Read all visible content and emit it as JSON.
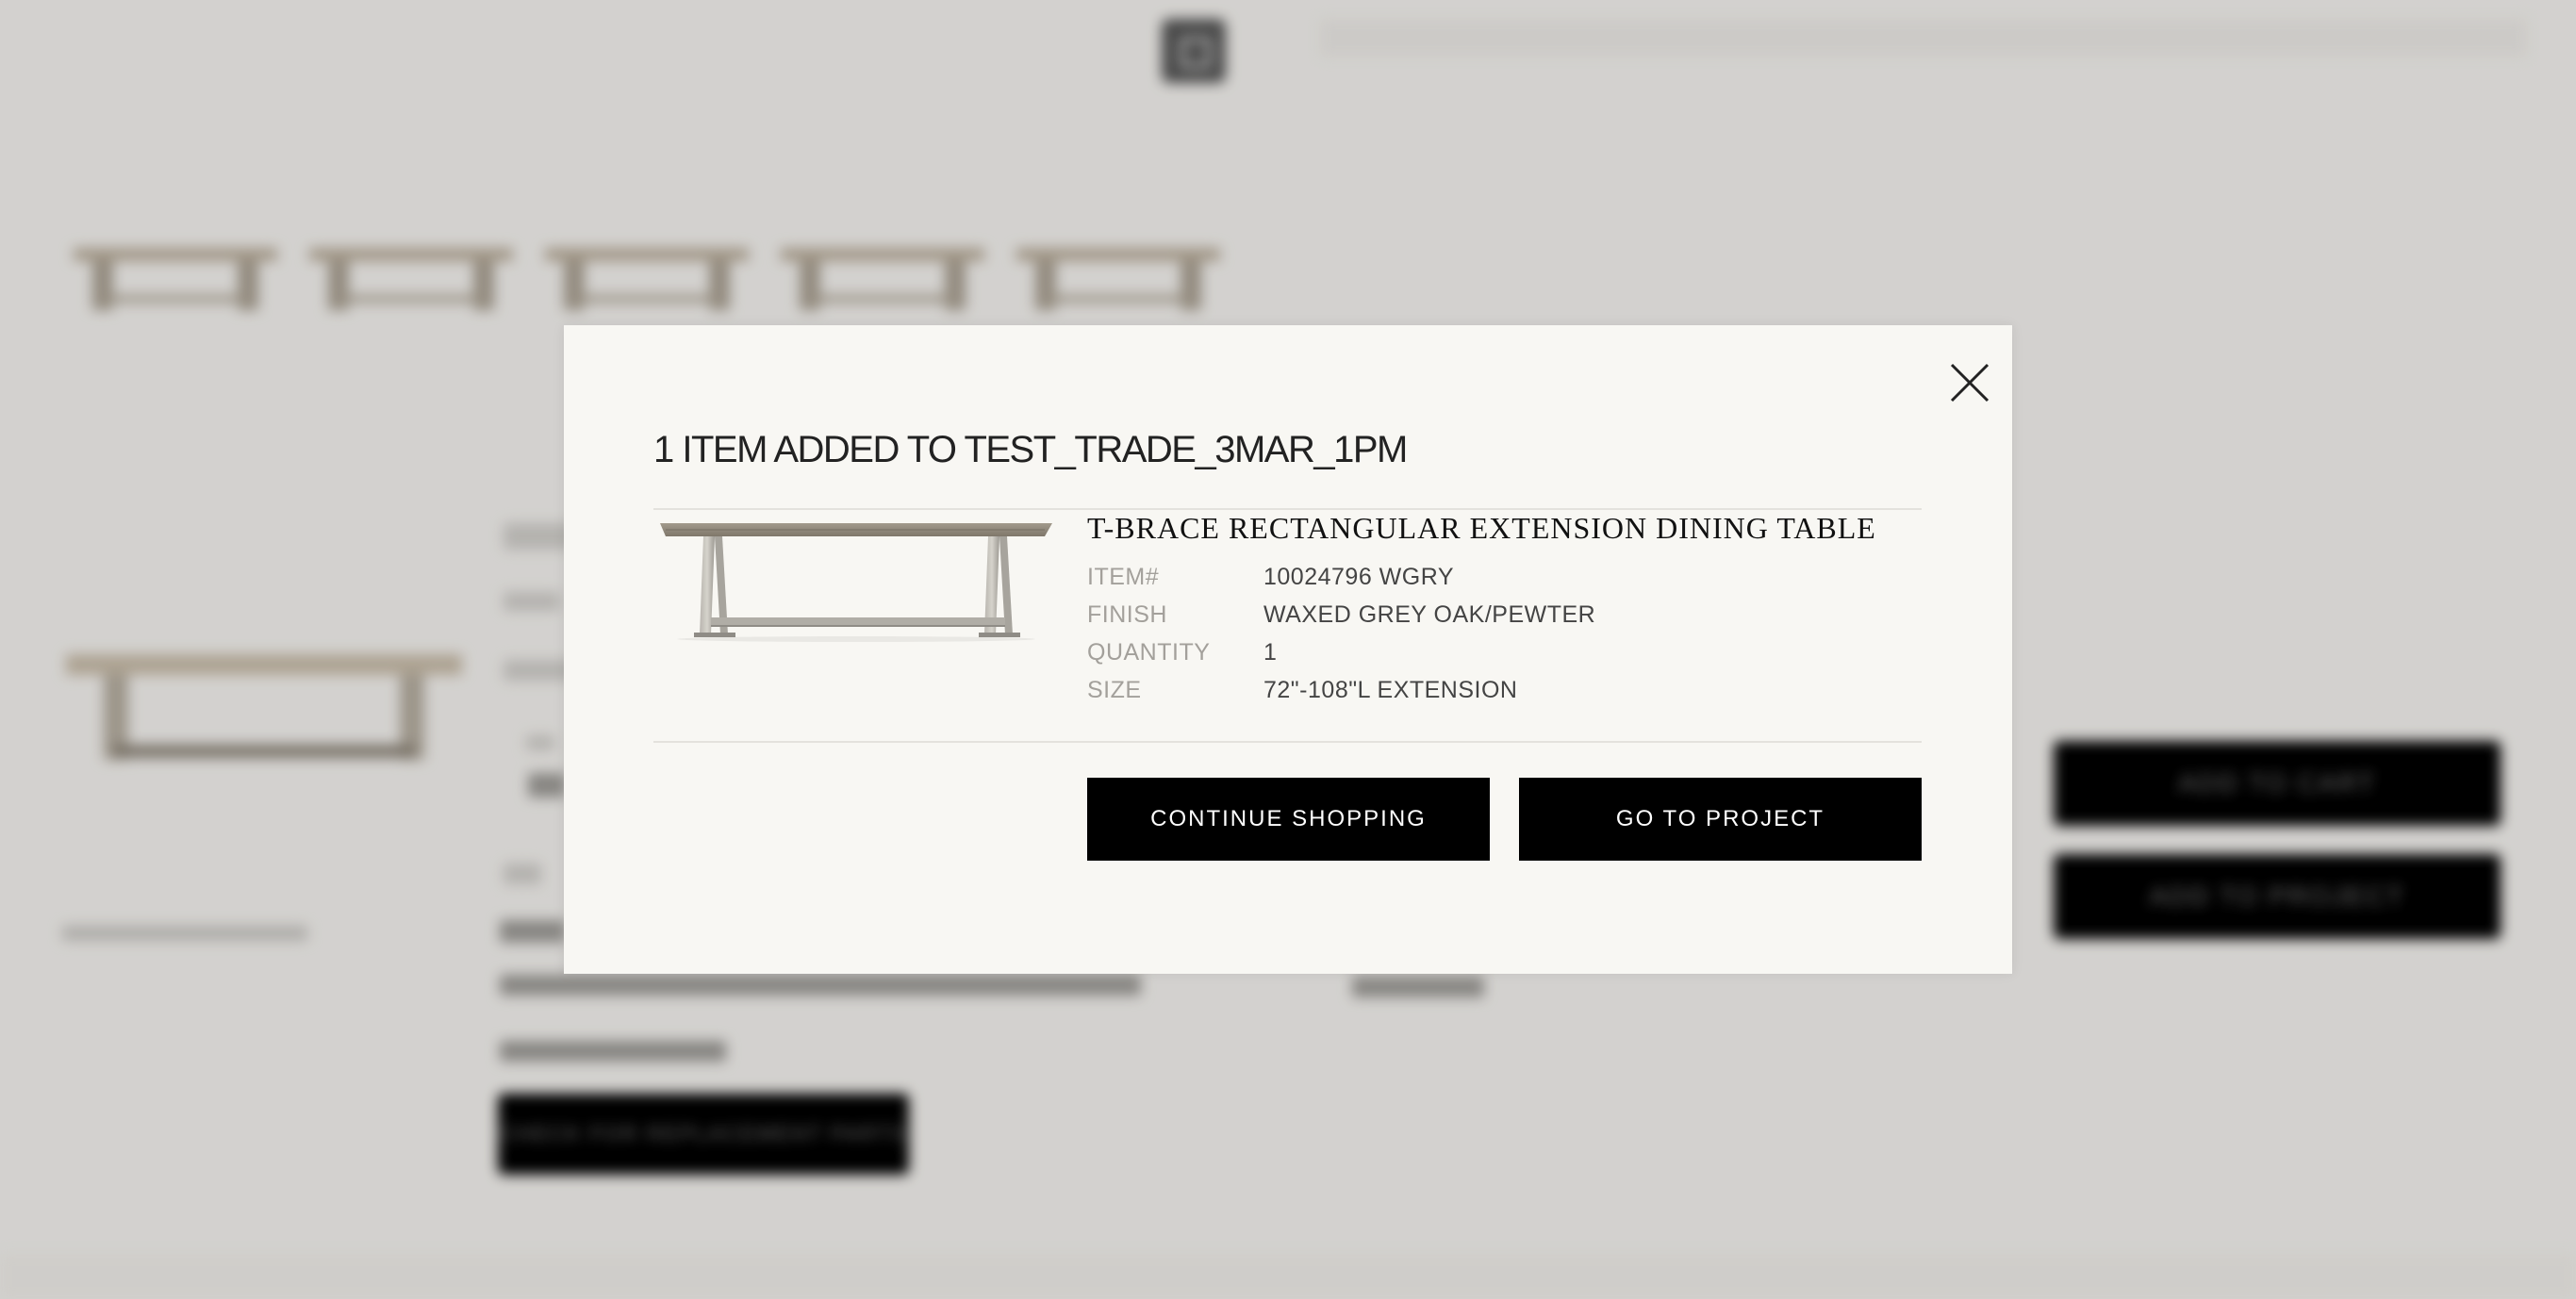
{
  "background": {
    "add_to_cart_label": "ADD TO CART",
    "add_to_project_label": "ADD TO PROJECT",
    "replacement_parts_label": "CHECK FOR REPLACEMENT PARTS"
  },
  "modal": {
    "title": "1 ITEM ADDED TO TEST_TRADE_3MAR_1PM",
    "close_icon": "close-icon",
    "product": {
      "name": "T-BRACE RECTANGULAR EXTENSION DINING TABLE",
      "image_icon": "dining-table-image",
      "specs": [
        {
          "label": "ITEM#",
          "value": "10024796 WGRY"
        },
        {
          "label": "FINISH",
          "value": "WAXED GREY OAK/PEWTER"
        },
        {
          "label": "QUANTITY",
          "value": "1"
        },
        {
          "label": "SIZE",
          "value": "72\"-108\"L EXTENSION"
        }
      ]
    },
    "buttons": {
      "continue_label": "CONTINUE SHOPPING",
      "project_label": "GO TO PROJECT"
    }
  },
  "colors": {
    "modal_background": "#f8f7f3",
    "button_background": "#000000",
    "button_text": "#ffffff",
    "label_text": "#a3a09b"
  }
}
